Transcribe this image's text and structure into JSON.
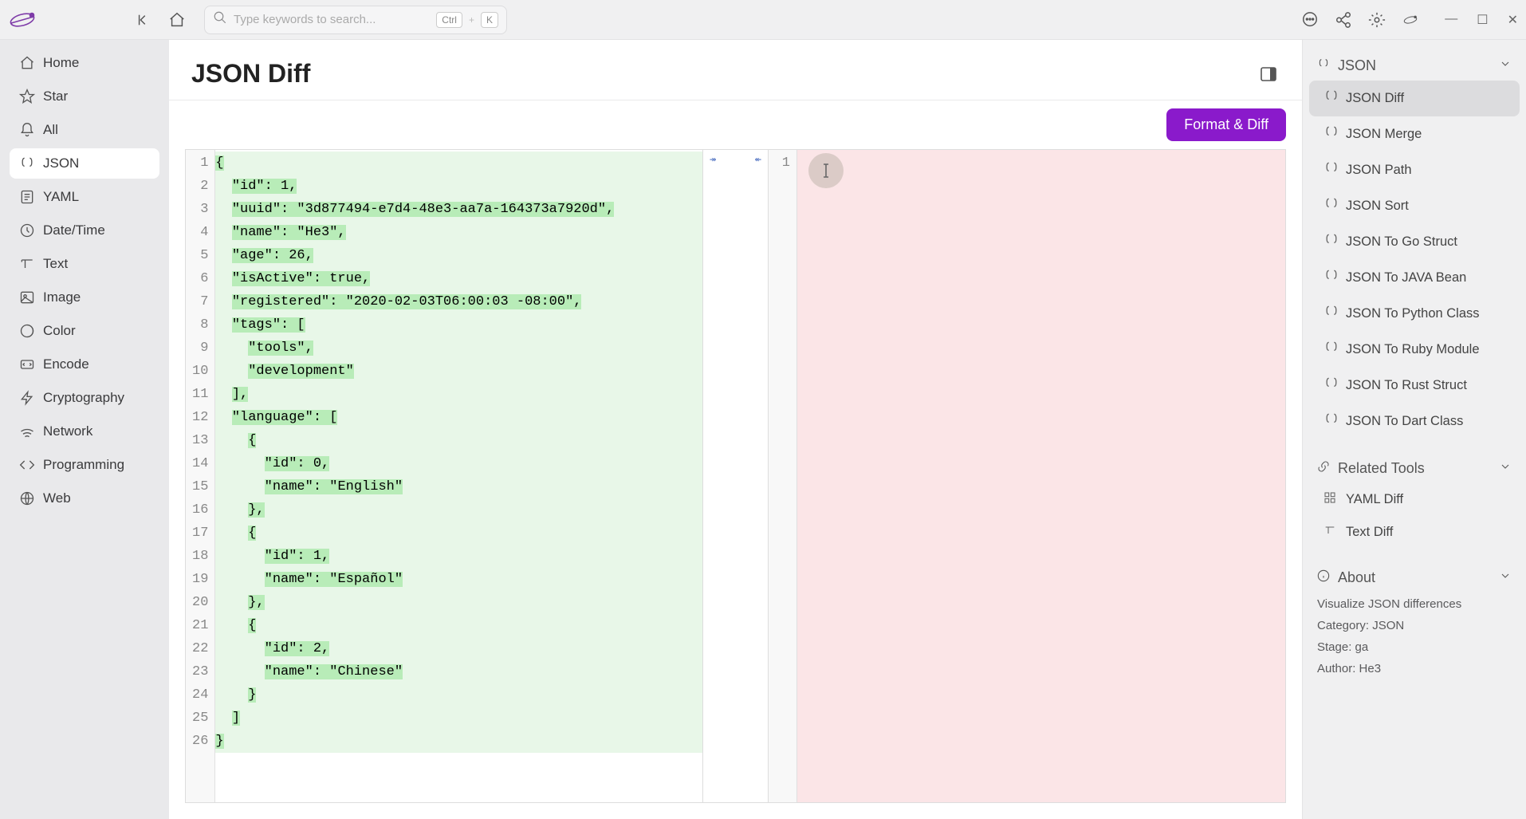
{
  "search": {
    "placeholder": "Type keywords to search...",
    "kbd1": "Ctrl",
    "kbd_plus": "+",
    "kbd2": "K"
  },
  "sidebar": {
    "items": [
      {
        "label": "Home",
        "icon": "home-icon"
      },
      {
        "label": "Star",
        "icon": "star-icon"
      },
      {
        "label": "All",
        "icon": "bell-icon"
      },
      {
        "label": "JSON",
        "icon": "json-icon"
      },
      {
        "label": "YAML",
        "icon": "yaml-icon"
      },
      {
        "label": "Date/Time",
        "icon": "clock-icon"
      },
      {
        "label": "Text",
        "icon": "text-icon"
      },
      {
        "label": "Image",
        "icon": "image-icon"
      },
      {
        "label": "Color",
        "icon": "color-icon"
      },
      {
        "label": "Encode",
        "icon": "encode-icon"
      },
      {
        "label": "Cryptography",
        "icon": "crypto-icon"
      },
      {
        "label": "Network",
        "icon": "network-icon"
      },
      {
        "label": "Programming",
        "icon": "programming-icon"
      },
      {
        "label": "Web",
        "icon": "web-icon"
      }
    ],
    "active_index": 3
  },
  "page": {
    "title": "JSON Diff",
    "format_button": "Format & Diff"
  },
  "editor": {
    "left_lines": [
      "{",
      "  \"id\": 1,",
      "  \"uuid\": \"3d877494-e7d4-48e3-aa7a-164373a7920d\",",
      "  \"name\": \"He3\",",
      "  \"age\": 26,",
      "  \"isActive\": true,",
      "  \"registered\": \"2020-02-03T06:00:03 -08:00\",",
      "  \"tags\": [",
      "    \"tools\",",
      "    \"development\"",
      "  ],",
      "  \"language\": [",
      "    {",
      "      \"id\": 0,",
      "      \"name\": \"English\"",
      "    },",
      "    {",
      "      \"id\": 1,",
      "      \"name\": \"Español\"",
      "    },",
      "    {",
      "      \"id\": 2,",
      "      \"name\": \"Chinese\"",
      "    }",
      "  ]",
      "}"
    ],
    "right_lines": [
      ""
    ]
  },
  "right_panel": {
    "json_header": "JSON",
    "json_items": [
      "JSON Diff",
      "JSON Merge",
      "JSON Path",
      "JSON Sort",
      "JSON To Go Struct",
      "JSON To JAVA Bean",
      "JSON To Python Class",
      "JSON To Ruby Module",
      "JSON To Rust Struct",
      "JSON To Dart Class"
    ],
    "json_active_index": 0,
    "related_header": "Related Tools",
    "related_items": [
      "YAML Diff",
      "Text Diff"
    ],
    "about_header": "About",
    "about": {
      "desc": "Visualize JSON differences",
      "category": "Category: JSON",
      "stage": "Stage: ga",
      "author": "Author: He3"
    }
  }
}
